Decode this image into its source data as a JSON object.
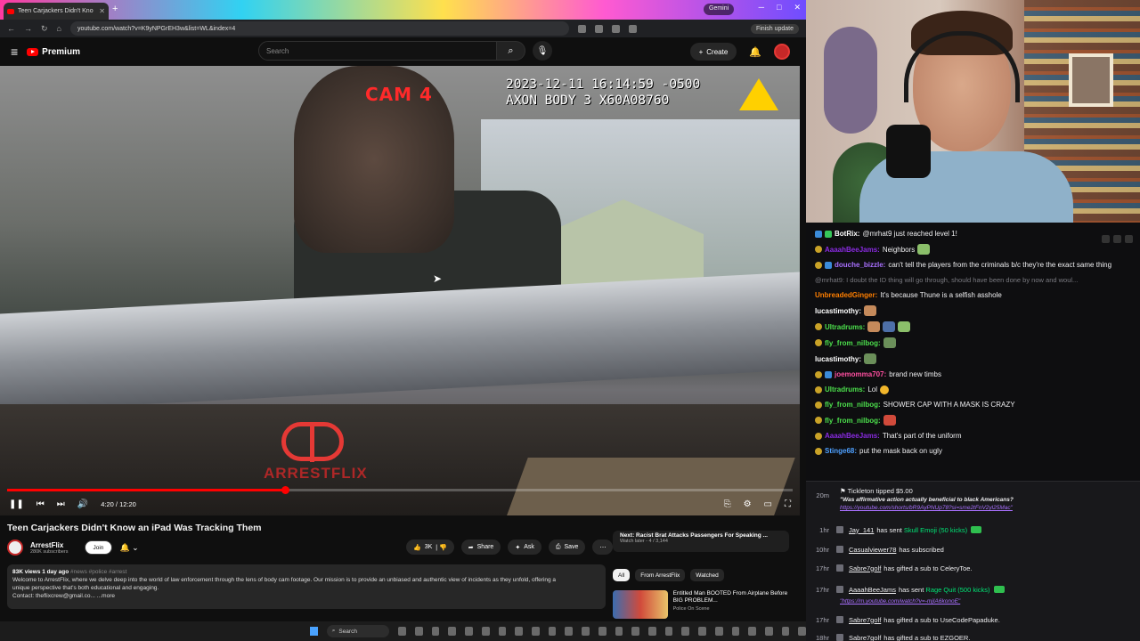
{
  "browser": {
    "tab_title": "Teen Carjackers Didn't Kno",
    "url": "youtube.com/watch?v=K9yNPGrEH3w&list=WL&index=4",
    "gemini_label": "Gemini",
    "update_label": "Finish update"
  },
  "youtube": {
    "logo_text": "Premium",
    "search_placeholder": "Search",
    "create_label": "Create"
  },
  "video": {
    "overlay_cam": "CAM 4",
    "overlay_timestamp": "2023-12-11 16:14:59 -0500",
    "overlay_device": "AXON BODY 3 X60A08760",
    "watermark_text": "ARRESTFLIX",
    "current_time": "4:20",
    "duration": "12:20",
    "time_display": "4:20 / 12:20",
    "progress_fraction": 0.354,
    "buffered_fraction": 0.41
  },
  "below": {
    "title": "Teen Carjackers Didn't Know an iPad Was Tracking Them",
    "channel_name": "ArrestFlix",
    "channel_subs": "280K subscribers",
    "join_label": "Join",
    "like_count": "3K",
    "share_label": "Share",
    "ask_label": "Ask",
    "save_label": "Save",
    "desc_meta": "83K views  1 day ago",
    "desc_tags": "#news #police #arrest",
    "desc_line1": "Welcome to ArrestFlix, where we delve deep into the world of law enforcement through the lens of body cam footage. Our mission is to provide an unbiased and authentic view of incidents as they unfold, offering a",
    "desc_line2": "unique perspective that's both educational and engaging.",
    "desc_contact": "Contact: theflixcrew@gmail.co...",
    "desc_more": "...more"
  },
  "sidebar": {
    "next_title": "Next: Racist Brat Attacks Passengers For Speaking ...",
    "next_sub": "Watch later - 4 / 3,144",
    "chips": [
      "All",
      "From ArrestFlix",
      "Watched"
    ],
    "rec_title": "Entitled Man BOOTED From Airplane Before BIG PROBLEM...",
    "rec_channel": "Police On Scene"
  },
  "taskbar": {
    "search_label": "Search"
  },
  "chat": {
    "messages": [
      {
        "user": "BotRix:",
        "text": "@mrhat9 just reached level 1!",
        "color": "#ffffff"
      },
      {
        "user": "AaaahBeeJams:",
        "text": "Neighbors",
        "color": "#8a2be2"
      },
      {
        "user": "douche_bizzle:",
        "text": "can't tell the players from the criminals b/c they're the exact same thing",
        "color": "#a970ff"
      },
      {
        "user": "",
        "text": "@mrhat9: I doubt the ID thing will go through, should have been done by now and woul...",
        "color": "#7a7a80"
      },
      {
        "user": "UnbreadedGinger:",
        "text": "It's because Thune is a selfish asshole",
        "color": "#ff7f00"
      },
      {
        "user": "lucastimothy:",
        "text": "",
        "color": "#ffffff"
      },
      {
        "user": "Ultradrums:",
        "text": "",
        "color": "#4ce04c"
      },
      {
        "user": "fly_from_nilbog:",
        "text": "",
        "color": "#4ce04c"
      },
      {
        "user": "lucastimothy:",
        "text": "",
        "color": "#ffffff"
      },
      {
        "user": "joemomma707:",
        "text": "brand new timbs",
        "color": "#ff4fa0"
      },
      {
        "user": "Ultradrums:",
        "text": "Lol",
        "color": "#4ce04c"
      },
      {
        "user": "fly_from_nilbog:",
        "text": "SHOWER CAP WITH A MASK IS CRAZY",
        "color": "#4ce04c"
      },
      {
        "user": "fly_from_nilbog:",
        "text": "",
        "color": "#4ce04c"
      },
      {
        "user": "AaaahBeeJams:",
        "text": "That's part of the uniform",
        "color": "#8a2be2"
      },
      {
        "user": "Stinge68:",
        "text": "put the mask back on ugly",
        "color": "#4ea0ff"
      }
    ]
  },
  "events": {
    "tip_time": "20m",
    "tip_line": "Tickleton tipped $5.00",
    "tip_quote": "\"Was affirmative action actually beneficial to black Americans?",
    "tip_link": "https://youtube.com/shorts/bR9AyPNUp78?si=sme2tFnV2yl25Mac\"",
    "rows": [
      {
        "time": "1hr",
        "name": "Jay_141",
        "text": "has sent",
        "extra": "Skull Emoji (50 kicks)"
      },
      {
        "time": "10hr",
        "name": "Casualviewer78",
        "text": "has subscribed",
        "extra": ""
      },
      {
        "time": "17hr",
        "name": "Sabre7golf",
        "text": "has gifted a sub to",
        "extra": "CeleryToe."
      },
      {
        "time": "17hr",
        "name": "AaaahBeeJams",
        "text": "has sent",
        "extra": "Rage Quit (500 kicks)"
      },
      {
        "time": "17hr",
        "name": "Sabre7golf",
        "text": "has gifted a sub to",
        "extra": "UseCodePapaduke."
      },
      {
        "time": "18hr",
        "name": "Sabre7golf",
        "text": "has gifted a sub to",
        "extra": "EZGOER."
      }
    ],
    "link_line": "\"https://m.youtube.com/watch?v=-mjIA6konoE\""
  },
  "colors": {
    "yt_red": "#ff0000",
    "chat_bg": "#0e0e10",
    "kick_green": "#00e676"
  }
}
